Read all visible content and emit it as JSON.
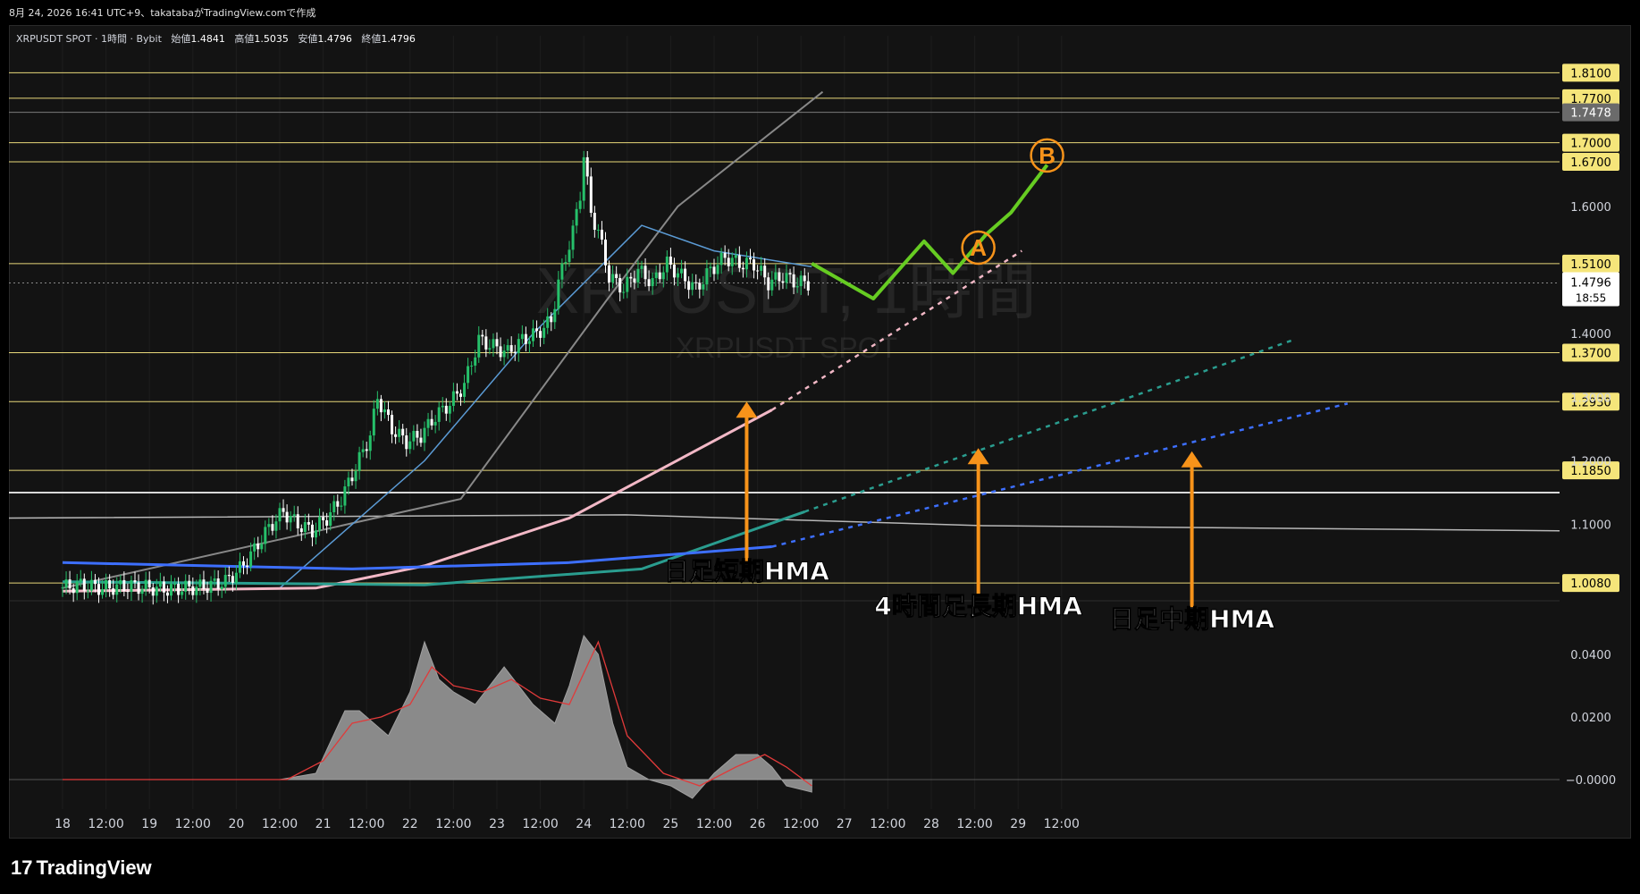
{
  "header_note": "8月 24, 2026 16:41 UTC+9、takatabaがTradingView.comで作成",
  "legend": {
    "symbol": "XRPUSDT SPOT · 1時間 · Bybit",
    "open_label": "始値",
    "open": "1.4841",
    "high_label": "高値",
    "high": "1.5035",
    "low_label": "安値",
    "low": "1.4796",
    "close_label": "終値",
    "close": "1.4796"
  },
  "watermark": {
    "line1": "XRPUSDT, 1時間",
    "line2": "XRPUSDT SPOT"
  },
  "footer": {
    "logo": "TradingView",
    "logo_mark": "17"
  },
  "colors": {
    "background": "#131313",
    "up": "#26c06a",
    "down": "#ffffff",
    "level_line": "#e8d87a",
    "projection": "#66cc22",
    "arrow": "#f7931a",
    "hma_short": "#f2b8c6",
    "hma_mid": "#3d6fff",
    "hma_long": "#2a9d8f"
  },
  "chart_data": [
    {
      "type": "candlestick",
      "title": "XRPUSDT SPOT · 1時間 · Bybit",
      "x_tick_labels": [
        "18",
        "12:00",
        "19",
        "12:00",
        "20",
        "12:00",
        "21",
        "12:00",
        "22",
        "12:00",
        "23",
        "12:00",
        "24",
        "12:00",
        "25",
        "12:00",
        "26",
        "12:00",
        "27",
        "12:00",
        "28",
        "12:00",
        "29",
        "12:00"
      ],
      "ylim": [
        0.98,
        1.84
      ],
      "y_tick_labels": [
        "1.6000",
        "1.4000",
        "1.3000",
        "1.2000",
        "1.1000"
      ],
      "current_price": "1.4796",
      "countdown": "18:55",
      "horizontal_levels": [
        {
          "value": 1.81,
          "label": "1.8100",
          "style": "yellow"
        },
        {
          "value": 1.77,
          "label": "1.7700",
          "style": "yellow"
        },
        {
          "value": 1.7478,
          "label": "1.7478",
          "style": "gray"
        },
        {
          "value": 1.7,
          "label": "1.7000",
          "style": "yellow"
        },
        {
          "value": 1.67,
          "label": "1.6700",
          "style": "yellow"
        },
        {
          "value": 1.51,
          "label": "1.5100",
          "style": "yellow"
        },
        {
          "value": 1.37,
          "label": "1.3700",
          "style": "yellow"
        },
        {
          "value": 1.293,
          "label": "1.2930",
          "style": "yellow"
        },
        {
          "value": 1.185,
          "label": "1.1850",
          "style": "yellow"
        },
        {
          "value": 1.008,
          "label": "1.0080",
          "style": "yellow"
        }
      ],
      "price_path": [
        [
          0,
          1.0
        ],
        [
          6,
          1.005
        ],
        [
          12,
          1.0
        ],
        [
          20,
          1.003
        ],
        [
          30,
          0.998
        ],
        [
          40,
          1.002
        ],
        [
          46,
          1.01
        ],
        [
          50,
          1.03
        ],
        [
          54,
          1.06
        ],
        [
          58,
          1.095
        ],
        [
          62,
          1.12
        ],
        [
          66,
          1.1
        ],
        [
          70,
          1.09
        ],
        [
          74,
          1.11
        ],
        [
          78,
          1.14
        ],
        [
          82,
          1.19
        ],
        [
          86,
          1.24
        ],
        [
          88,
          1.3
        ],
        [
          92,
          1.25
        ],
        [
          96,
          1.23
        ],
        [
          100,
          1.24
        ],
        [
          104,
          1.27
        ],
        [
          108,
          1.29
        ],
        [
          112,
          1.32
        ],
        [
          116,
          1.39
        ],
        [
          120,
          1.38
        ],
        [
          124,
          1.37
        ],
        [
          128,
          1.39
        ],
        [
          132,
          1.4
        ],
        [
          136,
          1.42
        ],
        [
          138,
          1.48
        ],
        [
          140,
          1.52
        ],
        [
          142,
          1.56
        ],
        [
          144,
          1.62
        ],
        [
          145,
          1.68
        ],
        [
          147,
          1.59
        ],
        [
          149,
          1.56
        ],
        [
          152,
          1.49
        ],
        [
          156,
          1.47
        ],
        [
          160,
          1.5
        ],
        [
          164,
          1.48
        ],
        [
          168,
          1.51
        ],
        [
          172,
          1.49
        ],
        [
          176,
          1.47
        ],
        [
          180,
          1.5
        ],
        [
          184,
          1.52
        ],
        [
          188,
          1.51
        ],
        [
          192,
          1.51
        ],
        [
          196,
          1.48
        ],
        [
          200,
          1.49
        ],
        [
          204,
          1.48
        ],
        [
          207,
          1.4796
        ]
      ],
      "projection_path": [
        [
          207,
          1.51
        ],
        [
          224,
          1.455
        ],
        [
          238,
          1.545
        ],
        [
          246,
          1.495
        ],
        [
          255,
          1.555
        ],
        [
          262,
          1.59
        ],
        [
          272,
          1.665
        ]
      ],
      "wave_labels": [
        {
          "label": "A",
          "x": 253,
          "y": 1.535
        },
        {
          "label": "B",
          "x": 272,
          "y": 1.68
        }
      ],
      "moving_averages": [
        {
          "name": "日足短期HMA",
          "color": "#f2b8c6",
          "solid": [
            [
              0,
              0.995
            ],
            [
              70,
              1.0
            ],
            [
              100,
              1.035
            ],
            [
              140,
              1.11
            ],
            [
              196,
              1.28
            ]
          ],
          "projected": [
            [
              196,
              1.28
            ],
            [
              265,
              1.53
            ]
          ],
          "label_x": 189,
          "label_y": 1.03,
          "arrow_x": 189,
          "arrow_tip": 1.293,
          "arrow_base": 1.04
        },
        {
          "name": "4時間足長期HMA",
          "color": "#2a9d8f",
          "solid": [
            [
              0,
              1.01
            ],
            [
              100,
              1.005
            ],
            [
              160,
              1.03
            ],
            [
              205,
              1.12
            ]
          ],
          "projected": [
            [
              205,
              1.12
            ],
            [
              340,
              1.39
            ]
          ],
          "label_x": 253,
          "label_y": 0.975,
          "arrow_x": 253,
          "arrow_tip": 1.22,
          "arrow_base": 0.99
        },
        {
          "name": "日足中期HMA",
          "color": "#3d6fff",
          "solid": [
            [
              0,
              1.04
            ],
            [
              80,
              1.03
            ],
            [
              140,
              1.04
            ],
            [
              196,
              1.065
            ]
          ],
          "projected": [
            [
              196,
              1.065
            ],
            [
              355,
              1.29
            ]
          ],
          "label_x": 312,
          "label_y": 0.955,
          "arrow_x": 312,
          "arrow_tip": 1.215,
          "arrow_base": 0.97
        }
      ]
    },
    {
      "type": "area",
      "title": "",
      "ylim": [
        -0.008,
        0.052
      ],
      "y_tick_labels": [
        "0.0400",
        "0.0200",
        "−0.0000"
      ],
      "area_series": [
        [
          0,
          0
        ],
        [
          60,
          0
        ],
        [
          70,
          0.002
        ],
        [
          74,
          0.012
        ],
        [
          78,
          0.022
        ],
        [
          82,
          0.022
        ],
        [
          86,
          0.018
        ],
        [
          90,
          0.014
        ],
        [
          96,
          0.028
        ],
        [
          100,
          0.044
        ],
        [
          104,
          0.032
        ],
        [
          108,
          0.028
        ],
        [
          114,
          0.024
        ],
        [
          118,
          0.03
        ],
        [
          122,
          0.036
        ],
        [
          126,
          0.03
        ],
        [
          130,
          0.024
        ],
        [
          136,
          0.018
        ],
        [
          140,
          0.03
        ],
        [
          144,
          0.046
        ],
        [
          148,
          0.04
        ],
        [
          152,
          0.018
        ],
        [
          156,
          0.004
        ],
        [
          162,
          0.0
        ],
        [
          168,
          -0.002
        ],
        [
          174,
          -0.006
        ],
        [
          180,
          0.002
        ],
        [
          186,
          0.008
        ],
        [
          192,
          0.008
        ],
        [
          196,
          0.004
        ],
        [
          200,
          -0.002
        ],
        [
          207,
          -0.004
        ]
      ],
      "signal_series": [
        [
          0,
          0
        ],
        [
          62,
          0
        ],
        [
          72,
          0.006
        ],
        [
          80,
          0.018
        ],
        [
          88,
          0.02
        ],
        [
          96,
          0.024
        ],
        [
          102,
          0.036
        ],
        [
          108,
          0.03
        ],
        [
          116,
          0.028
        ],
        [
          124,
          0.032
        ],
        [
          132,
          0.026
        ],
        [
          140,
          0.024
        ],
        [
          148,
          0.044
        ],
        [
          156,
          0.014
        ],
        [
          166,
          0.002
        ],
        [
          176,
          -0.002
        ],
        [
          186,
          0.004
        ],
        [
          194,
          0.008
        ],
        [
          200,
          0.004
        ],
        [
          207,
          -0.002
        ]
      ]
    }
  ]
}
